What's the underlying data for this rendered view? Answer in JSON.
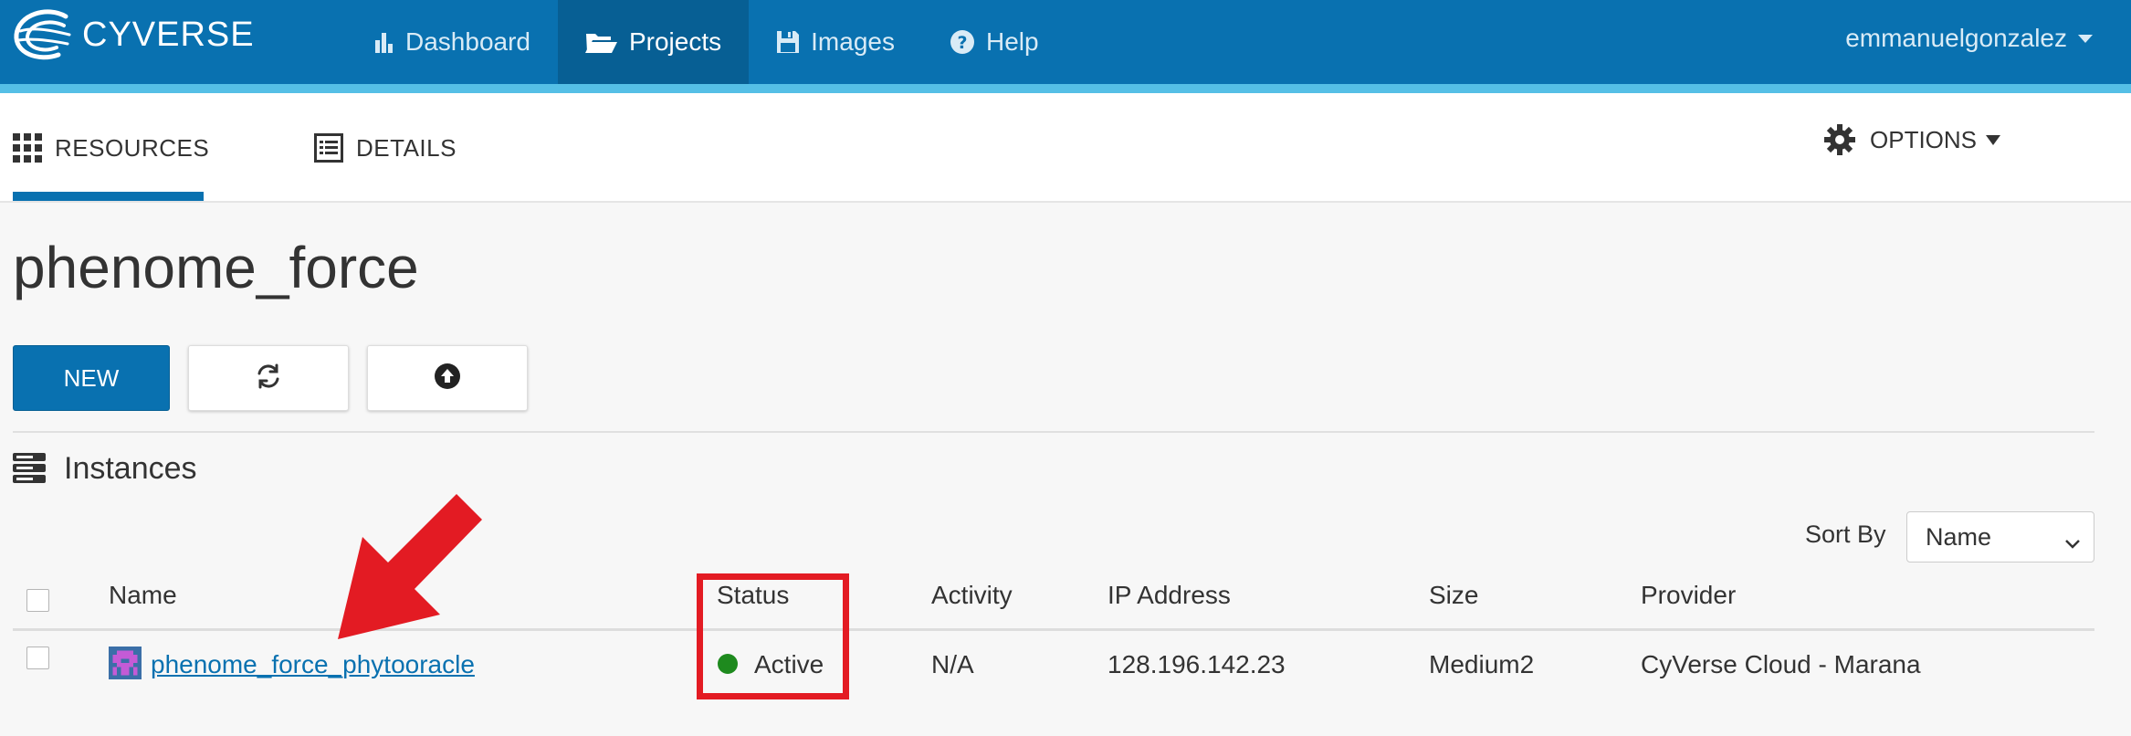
{
  "header": {
    "brand": "CYVERSE",
    "nav": [
      {
        "label": "Dashboard",
        "icon": "bar-chart-icon",
        "active": false
      },
      {
        "label": "Projects",
        "icon": "folder-open-icon",
        "active": true
      },
      {
        "label": "Images",
        "icon": "floppy-disk-icon",
        "active": false
      },
      {
        "label": "Help",
        "icon": "question-circle-icon",
        "active": false
      }
    ],
    "user": "emmanuelgonzalez"
  },
  "tabs": {
    "resources": "RESOURCES",
    "details": "DETAILS",
    "options": "OPTIONS"
  },
  "project": {
    "title": "phenome_force",
    "new_label": "NEW"
  },
  "instances": {
    "section_label": "Instances",
    "sort_by_label": "Sort By",
    "sort_by_value": "Name",
    "columns": {
      "name": "Name",
      "status": "Status",
      "activity": "Activity",
      "ip": "IP Address",
      "size": "Size",
      "provider": "Provider"
    },
    "rows": [
      {
        "name": "phenome_force_phytooracle",
        "status": "Active",
        "activity": "N/A",
        "ip": "128.196.142.23",
        "size": "Medium2",
        "provider": "CyVerse Cloud - Marana"
      }
    ]
  },
  "colors": {
    "brand_blue": "#0971b0",
    "stripe": "#55bfe6",
    "status_active": "#1e8a1e",
    "annotation_red": "#e31b23"
  }
}
